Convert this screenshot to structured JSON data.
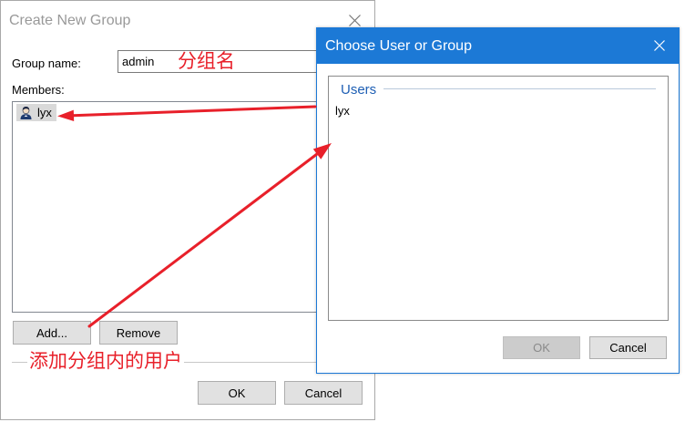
{
  "colors": {
    "accent": "#1c79d6",
    "annotation": "#e8202a",
    "group_header": "#1e5fb4"
  },
  "create_dialog": {
    "title": "Create New Group",
    "close_icon": "close-icon",
    "group_name_label": "Group name:",
    "group_name_value": "admin",
    "members_label": "Members:",
    "members": [
      {
        "name": "lyx",
        "icon": "user-icon",
        "selected": true
      }
    ],
    "add_label": "Add...",
    "remove_label": "Remove",
    "ok_label": "OK",
    "cancel_label": "Cancel"
  },
  "choose_dialog": {
    "title": "Choose User or Group",
    "close_icon": "close-icon",
    "group_header": "Users",
    "items": [
      {
        "name": "lyx"
      }
    ],
    "ok_label": "OK",
    "ok_disabled": true,
    "cancel_label": "Cancel"
  },
  "annotations": {
    "group_name_note": "分组名",
    "add_members_note": "添加分组内的用户"
  }
}
